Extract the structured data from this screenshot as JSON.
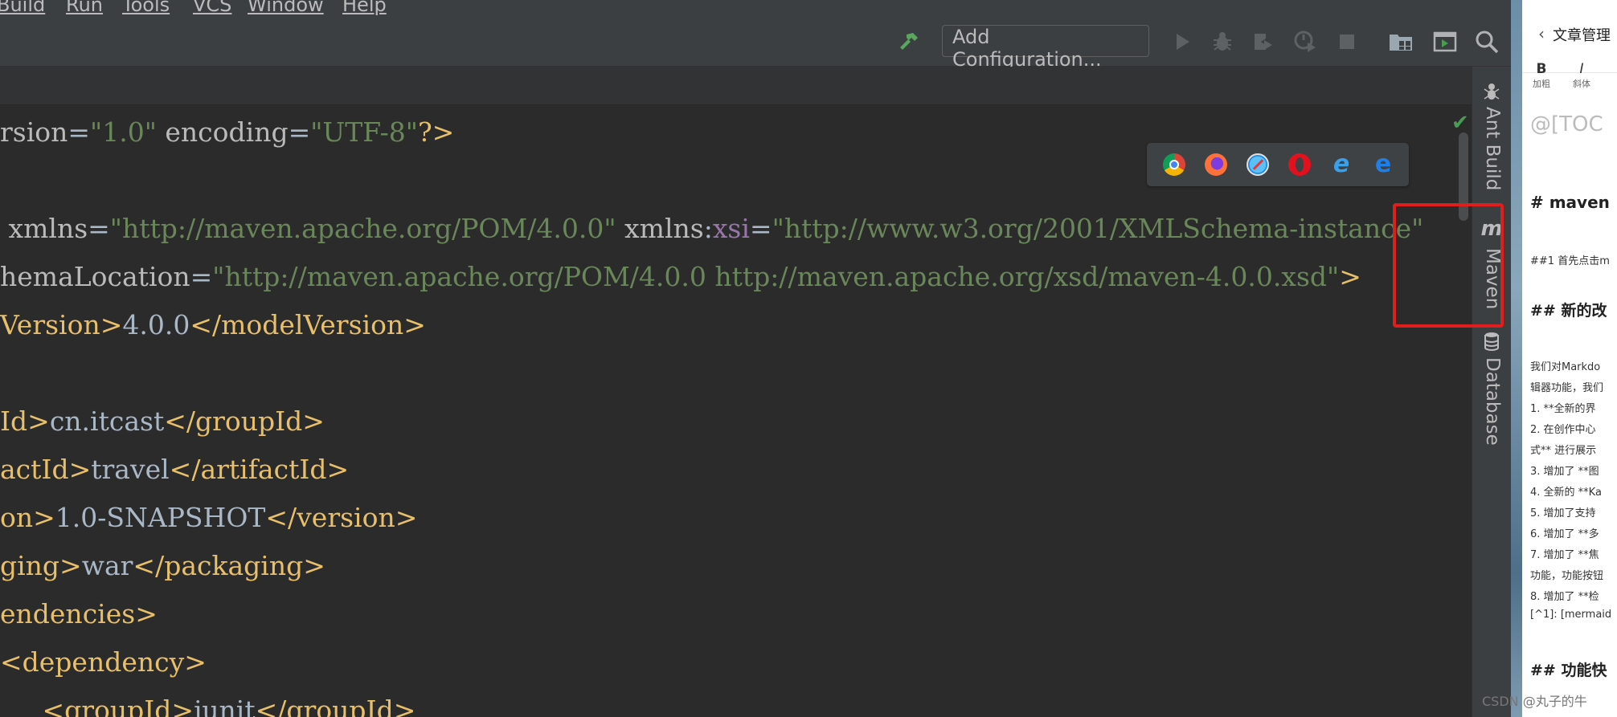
{
  "menu": [
    "Build",
    "Run",
    "Tools",
    "VCS",
    "Window",
    "Help"
  ],
  "toolbar": {
    "add_configuration": "Add Configuration...",
    "icons": [
      "build-hammer-icon",
      "run-icon",
      "debug-icon",
      "coverage-icon",
      "profile-icon",
      "stop-icon",
      "project-structure-icon",
      "run-anything-icon",
      "search-icon"
    ]
  },
  "editor": {
    "lines": [
      [
        [
          "t-attr",
          "rsion"
        ],
        [
          "t-text",
          "="
        ],
        [
          "t-val",
          "\"1.0\""
        ],
        [
          "t-attr",
          " encoding"
        ],
        [
          "t-text",
          "="
        ],
        [
          "t-val",
          "\"UTF-8\""
        ],
        [
          "t-tag",
          "?>"
        ]
      ],
      [],
      [
        [
          "t-attr",
          " xmlns"
        ],
        [
          "t-text",
          "="
        ],
        [
          "t-val",
          "\"http://maven.apache.org/POM/4.0.0\""
        ],
        [
          "t-attr",
          " xmlns"
        ],
        [
          "t-text",
          ":"
        ],
        [
          "t-ns",
          "xsi"
        ],
        [
          "t-text",
          "="
        ],
        [
          "t-val",
          "\"http://www.w3.org/2001/XMLSchema-instance\""
        ]
      ],
      [
        [
          "t-attr",
          "hemaLocation"
        ],
        [
          "t-text",
          "="
        ],
        [
          "t-val",
          "\"http://maven.apache.org/POM/4.0.0 http://maven.apache.org/xsd/maven-4.0.0.xsd\""
        ],
        [
          "t-tag",
          ">"
        ]
      ],
      [
        [
          "t-tag",
          "Version>"
        ],
        [
          "t-text",
          "4.0.0"
        ],
        [
          "t-tag",
          "</modelVersion>"
        ]
      ],
      [],
      [
        [
          "t-tag",
          "Id>"
        ],
        [
          "t-text",
          "cn.itcast"
        ],
        [
          "t-tag",
          "</groupId>"
        ]
      ],
      [
        [
          "t-tag",
          "actId>"
        ],
        [
          "t-text",
          "travel"
        ],
        [
          "t-tag",
          "</artifactId>"
        ]
      ],
      [
        [
          "t-tag",
          "on>"
        ],
        [
          "t-text",
          "1.0-SNAPSHOT"
        ],
        [
          "t-tag",
          "</version>"
        ]
      ],
      [
        [
          "t-tag",
          "ging>"
        ],
        [
          "t-text",
          "war"
        ],
        [
          "t-tag",
          "</packaging>"
        ]
      ],
      [
        [
          "t-tag",
          "endencies>"
        ]
      ],
      [
        [
          "t-tag",
          "<dependency>"
        ]
      ],
      [
        [
          "t-tag",
          "     <groupId>"
        ],
        [
          "t-text",
          "junit"
        ],
        [
          "t-tag",
          "</groupId>"
        ]
      ]
    ]
  },
  "browser_popup": [
    "chrome-icon",
    "firefox-icon",
    "safari-icon",
    "opera-icon",
    "ie-icon",
    "edge-icon"
  ],
  "right_panel": {
    "ant_build": "Ant Build",
    "maven": "Maven",
    "database": "Database"
  },
  "csdn": {
    "back_label": "文章管理",
    "bold_label": "B",
    "bold_caption": "加粗",
    "italic_label": "I",
    "italic_caption": "斜体",
    "placeholder_line": "@[TOC",
    "heading_1": "# maven",
    "subheading_1": "##1 首先点击m",
    "heading_2": "## 新的改",
    "para_1": "我们对Markdo",
    "para_2": "辑器功能，我们",
    "list": [
      "1. **全新的界",
      "2. 在创作中心",
      "式** 进行展示",
      "3. 增加了 **图",
      "4. 全新的 **Ka",
      "5. 增加了支持",
      "6. 增加了 **多",
      "7. 增加了 **焦",
      "功能，功能按钮",
      "8. 增加了 **检"
    ],
    "footnote": "[^1]: [mermaid",
    "heading_3": "## 功能快",
    "watermark": "CSDN @丸子的牛"
  }
}
